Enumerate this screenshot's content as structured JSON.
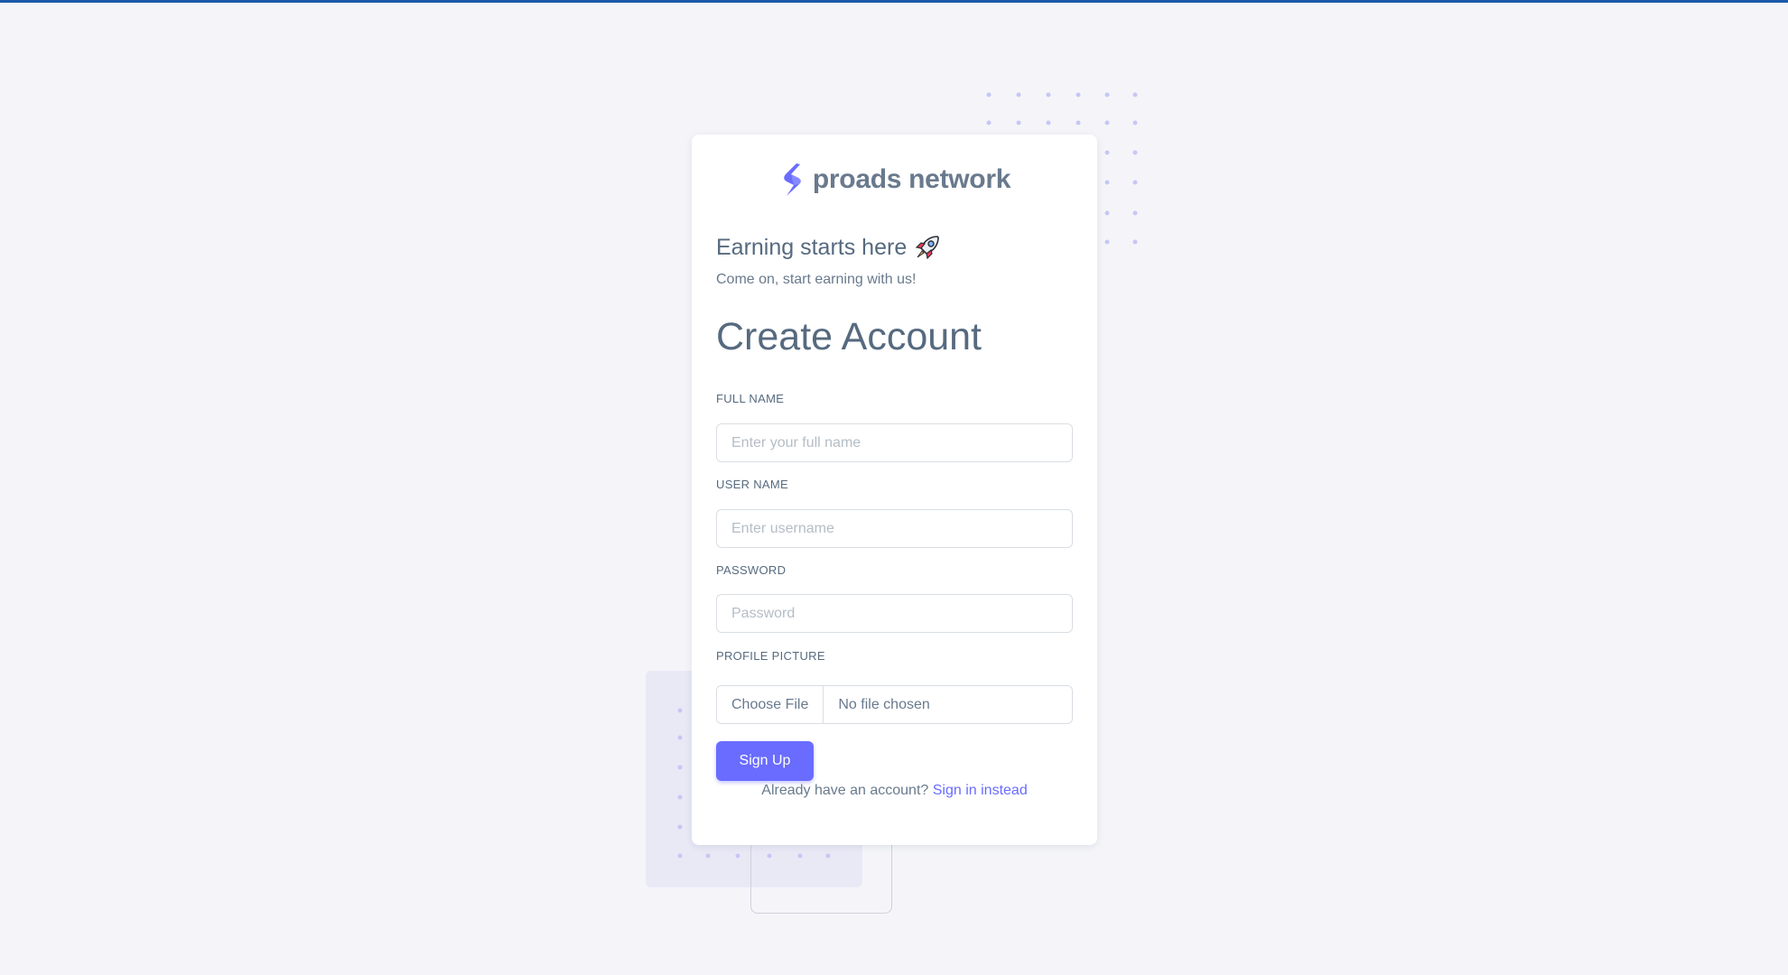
{
  "brand": {
    "name": "proads network",
    "logo_icon": "brand-s-logo-icon",
    "accent_color": "#696cff",
    "text_color": "#697a8d"
  },
  "welcome": {
    "title": "Earning starts here",
    "icon": "rocket-icon",
    "subtitle": "Come on, start earning with us!"
  },
  "form": {
    "heading": "Create Account",
    "full_name": {
      "label": "FULL NAME",
      "placeholder": "Enter your full name",
      "value": ""
    },
    "username": {
      "label": "USER NAME",
      "placeholder": "Enter username",
      "value": ""
    },
    "password": {
      "label": "PASSWORD",
      "placeholder": "Password",
      "value": ""
    },
    "profile_picture": {
      "label": "PROFILE PICTURE",
      "button_label": "Choose File",
      "status": "No file chosen"
    },
    "submit_label": "Sign Up"
  },
  "signin": {
    "prompt": "Already have an account?",
    "link_label": "Sign in instead"
  },
  "colors": {
    "page_background": "#f5f5f9",
    "top_bar": "#1b5aa8",
    "button": "#696cff"
  }
}
